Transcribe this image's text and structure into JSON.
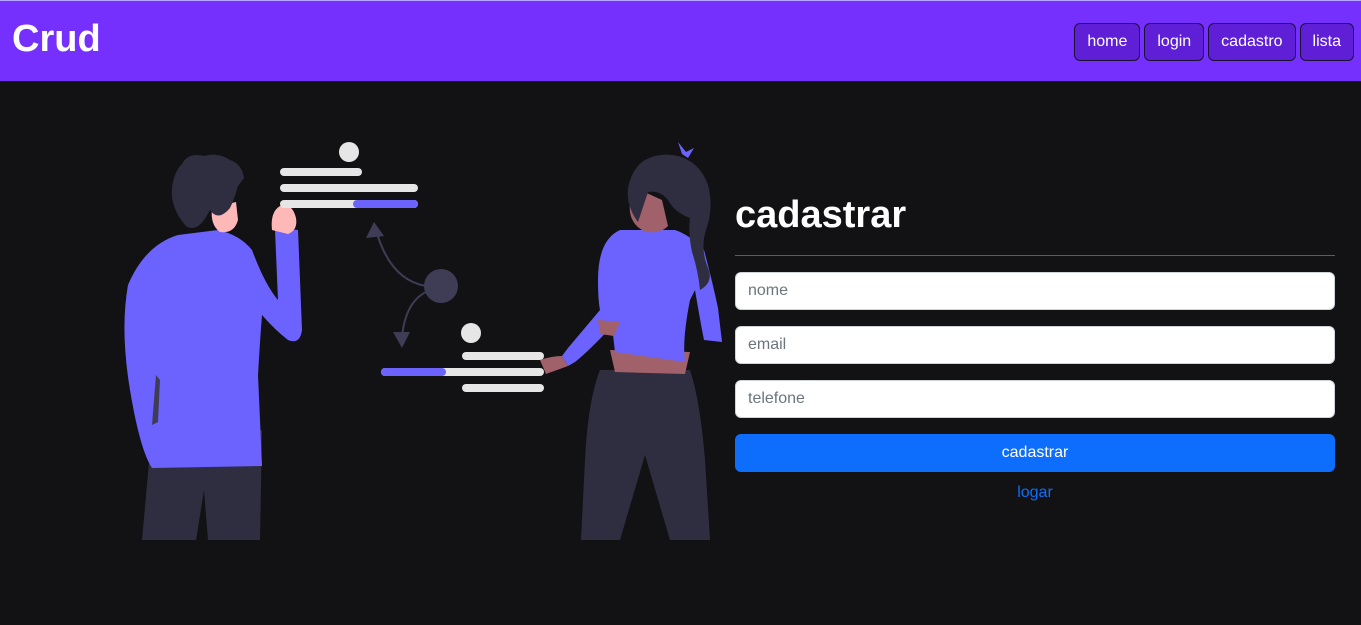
{
  "header": {
    "brand": "Crud",
    "nav": [
      "home",
      "login",
      "cadastro",
      "lista"
    ]
  },
  "form": {
    "title": "cadastrar",
    "fields": {
      "name_placeholder": "nome",
      "email_placeholder": "email",
      "phone_placeholder": "telefone"
    },
    "submit_label": "cadastrar",
    "login_link": "logar"
  },
  "colors": {
    "header_bg": "#7530fe",
    "page_bg": "#121214",
    "primary": "#0d6efd",
    "illustration_accent": "#6c63ff"
  },
  "illustration": {
    "icons": [
      "person-man-icon",
      "person-woman-icon",
      "progress-card-icon"
    ]
  }
}
